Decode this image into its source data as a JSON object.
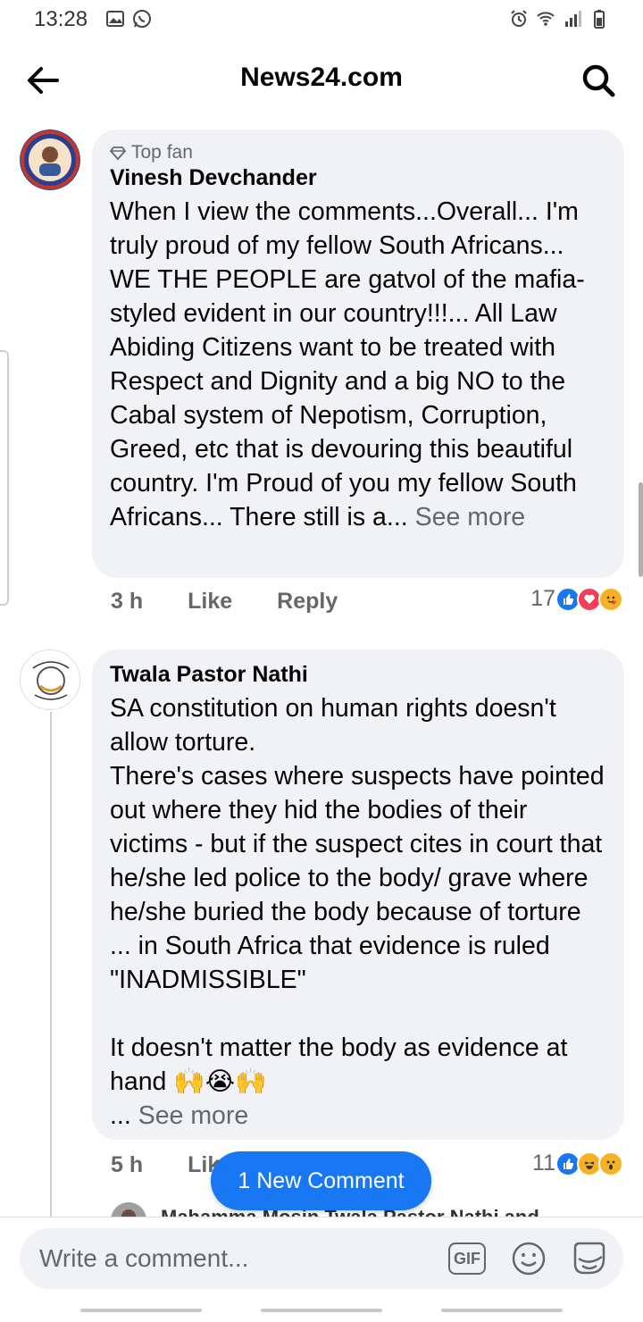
{
  "status_bar": {
    "time": "13:28"
  },
  "header": {
    "title": "News24.com"
  },
  "comments": [
    {
      "badge": "Top fan",
      "author": "Vinesh Devchander",
      "text": "When I view the comments...Overall... I'm truly proud of my fellow South Africans... WE THE PEOPLE are gatvol of the mafia-styled evident in our country!!!... All Law Abiding Citizens want to be treated with Respect and Dignity and a big NO to the Cabal system of Nepotism, Corruption, Greed, etc that is devouring this beautiful country. I'm Proud of you my fellow South Africans... There still is a... ",
      "see_more": "See more",
      "time": "3 h",
      "like": "Like",
      "reply": "Reply",
      "reaction_count": "17",
      "reactions": [
        "like",
        "love",
        "care"
      ]
    },
    {
      "author": "Twala Pastor Nathi",
      "text": "SA constitution on human rights doesn't allow torture.\nThere's cases where suspects have pointed out where they hid the bodies of their victims - but if the suspect cites in court that he/she led police to the body/ grave where he/she buried the body because of torture ... in South Africa that evidence is ruled \"INADMISSIBLE\"\n\nIt doesn't matter the body as evidence at hand 🙌😭🙌\n... ",
      "see_more": "See more",
      "time": "5 h",
      "like": "Like",
      "reaction_count": "11",
      "reactions": [
        "like",
        "haha",
        "wow"
      ]
    }
  ],
  "reply_peek": "Mahamma Mosin Twala Pastor Nathi and",
  "new_comment_button": "1 New Comment",
  "composer": {
    "placeholder": "Write a comment...",
    "gif_label": "GIF"
  },
  "colors": {
    "accent": "#1877f2",
    "bubble": "#f0f2f5",
    "secondary_text": "#65676b"
  }
}
